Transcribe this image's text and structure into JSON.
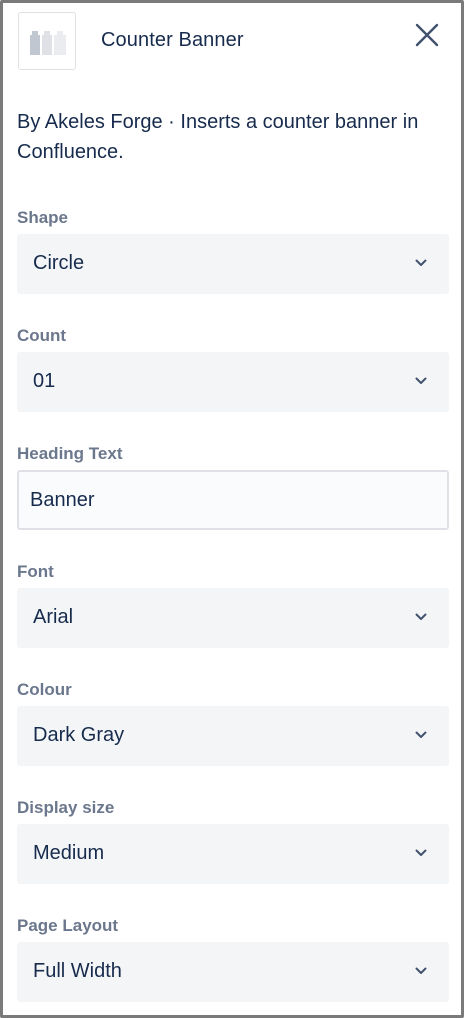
{
  "header": {
    "title": "Counter Banner",
    "app_icon": "lego-blocks-icon",
    "close_icon": "close-icon"
  },
  "description": "By Akeles Forge · Inserts a counter banner in Confluence.",
  "fields": {
    "shape": {
      "label": "Shape",
      "value": "Circle"
    },
    "count": {
      "label": "Count",
      "value": "01"
    },
    "heading": {
      "label": "Heading Text",
      "value": "Banner"
    },
    "font": {
      "label": "Font",
      "value": "Arial"
    },
    "colour": {
      "label": "Colour",
      "value": "Dark Gray"
    },
    "size": {
      "label": "Display size",
      "value": "Medium"
    },
    "layout": {
      "label": "Page Layout",
      "value": "Full Width"
    }
  },
  "colors": {
    "text": "#172b4d",
    "label": "#6b778c",
    "field_bg": "#f4f5f7",
    "border": "#dfe1e6"
  }
}
